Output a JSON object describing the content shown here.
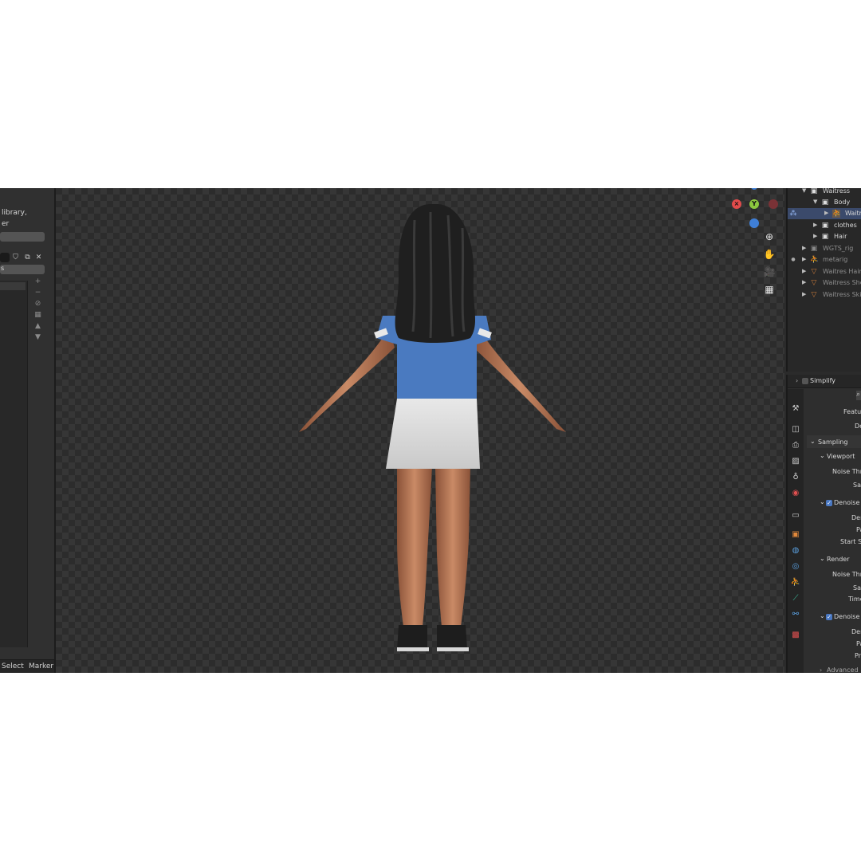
{
  "left_panel": {
    "line1": "library,",
    "line2": "er",
    "field_label": "s",
    "bottom_menu": [
      "Select",
      "Marker"
    ]
  },
  "viewport": {
    "gizmo": {
      "y_label": "Y"
    },
    "nav_icons": [
      "zoom-icon",
      "hand-icon",
      "camera-icon",
      "grid-icon"
    ],
    "colors": {
      "x": "#e14b4b",
      "y": "#8cc63f",
      "z": "#3f7fd6"
    }
  },
  "outliner": {
    "rows": [
      {
        "label": "Waitress",
        "icon": "collection-icon",
        "selected": false,
        "dim": false
      },
      {
        "label": "Body",
        "icon": "collection-icon",
        "selected": false,
        "dim": false
      },
      {
        "label": "Waitr",
        "icon": "armature-icon",
        "selected": true,
        "dim": false
      },
      {
        "label": "clothes",
        "icon": "collection-icon",
        "selected": false,
        "dim": false
      },
      {
        "label": "Hair",
        "icon": "collection-icon",
        "selected": false,
        "dim": false
      },
      {
        "label": "WGTS_rig",
        "icon": "collection-icon",
        "selected": false,
        "dim": true
      },
      {
        "label": "metarig",
        "icon": "armature-icon",
        "selected": false,
        "dim": true
      },
      {
        "label": "Waitres Hair",
        "icon": "mesh-icon",
        "selected": false,
        "dim": true
      },
      {
        "label": "Waitress Shoe",
        "icon": "mesh-icon",
        "selected": false,
        "dim": true
      },
      {
        "label": "Waitress Skin",
        "icon": "mesh-icon",
        "selected": false,
        "dim": true
      }
    ]
  },
  "properties": {
    "simplify": "Simplify",
    "feature_label": "Featur",
    "de_label": "De",
    "sampling": "Sampling",
    "viewport_section": "Viewport",
    "noise_threshold": "Noise Thre",
    "samples": "Sa",
    "denoise": "Denoise",
    "denoiser": "Den",
    "passes": "Pa",
    "start_sample": "Start Sa",
    "render_section": "Render",
    "noise_threshold_render": "Noise Thre",
    "samples_render": "Sar",
    "time_limit": "Time",
    "denoise_render": "Denoise",
    "denoiser_render": "Den",
    "passes_render": "Pa",
    "prefilter": "Pre",
    "advanced": "Advanced"
  }
}
